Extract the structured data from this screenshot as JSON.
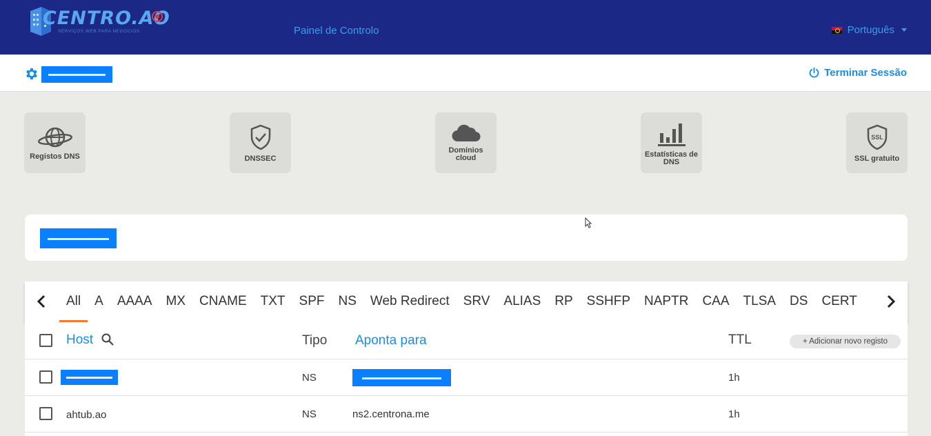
{
  "header": {
    "logo_text": "CENTRO.AO",
    "logo_subtitle": "SERVIÇOS WEB PARA NEGÓCIOS",
    "panel_link": "Painel de Controlo",
    "language": "Português"
  },
  "userbar": {
    "logout_label": "Terminar Sessão"
  },
  "features": [
    {
      "label": "Registos DNS",
      "icon": "globe-icon"
    },
    {
      "label": "DNSSEC",
      "icon": "shield-check-icon"
    },
    {
      "label": "Domínios cloud",
      "icon": "cloud-icon"
    },
    {
      "label": "Estatísticas de DNS",
      "icon": "bar-chart-icon"
    },
    {
      "label": "SSL gratuito",
      "icon": "ssl-shield-icon"
    }
  ],
  "tabs": [
    "All",
    "A",
    "AAAA",
    "MX",
    "CNAME",
    "TXT",
    "SPF",
    "NS",
    "Web Redirect",
    "SRV",
    "ALIAS",
    "RP",
    "SSHFP",
    "NAPTR",
    "CAA",
    "TLSA",
    "DS",
    "CERT"
  ],
  "table": {
    "headers": {
      "host": "Host",
      "type": "Tipo",
      "points_to": "Aponta para",
      "ttl": "TTL",
      "add_button": "+ Adicionar novo registo"
    },
    "rows": [
      {
        "host": "",
        "type": "NS",
        "points_to": "",
        "ttl": "1h"
      },
      {
        "host": "ahtub.ao",
        "type": "NS",
        "points_to": "ns2.centrona.me",
        "ttl": "1h"
      }
    ]
  }
}
